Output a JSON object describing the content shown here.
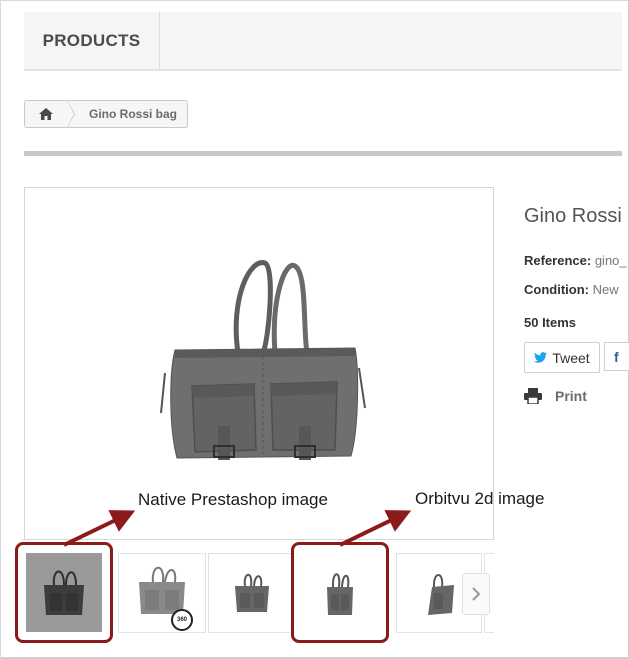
{
  "nav": {
    "products_label": "PRODUCTS"
  },
  "breadcrumb": {
    "home_icon": "home-icon",
    "current": "Gino Rossi bag"
  },
  "product": {
    "title": "Gino Rossi",
    "reference_label": "Reference:",
    "reference_value": "gino_",
    "condition_label": "Condition:",
    "condition_value": "New",
    "stock": "50 Items",
    "tweet_label": "Tweet",
    "facebook_label": "f",
    "print_label": "Print"
  },
  "annotations": {
    "native": "Native Prestashop image",
    "orbitvu": "Orbitvu 2d image"
  },
  "thumbnails": {
    "badge_360": "360",
    "next_icon": "chevron-right-icon"
  },
  "colors": {
    "annotation_red": "#8b1a1a",
    "twitter_blue": "#1da1f2",
    "facebook_blue": "#3b5998"
  }
}
